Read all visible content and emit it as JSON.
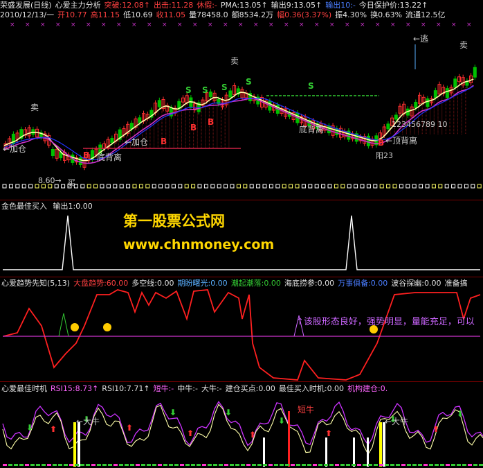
{
  "header": {
    "line1": [
      {
        "text": "荣盛发展(日线)",
        "color": "#e0e0e0"
      },
      {
        "text": "心爱主力分析",
        "color": "#e0e0e0"
      },
      {
        "text": "突破:12.08↑",
        "color": "#ff4040"
      },
      {
        "text": "出击:11.28",
        "color": "#ff4040"
      },
      {
        "text": "休假:-",
        "color": "#ff4040"
      },
      {
        "text": "PMA:13.05↑",
        "color": "#e0e0e0"
      },
      {
        "text": "输出9:13.05↑",
        "color": "#e0e0e0"
      },
      {
        "text": "输出10:-",
        "color": "#4a7dff"
      },
      {
        "text": "今日保护价:13.22↑",
        "color": "#e0e0e0"
      }
    ],
    "line2": [
      {
        "text": "2010/12/13/一",
        "color": "#e0e0e0"
      },
      {
        "text": "开10.77",
        "color": "#ff4040"
      },
      {
        "text": "高11.15",
        "color": "#ff4040"
      },
      {
        "text": "低10.69",
        "color": "#e0e0e0"
      },
      {
        "text": "收11.05",
        "color": "#ff4040"
      },
      {
        "text": "量78458.0",
        "color": "#e0e0e0"
      },
      {
        "text": "额8534.2万",
        "color": "#e0e0e0"
      },
      {
        "text": "幅0.36(3.37%)",
        "color": "#ff4040"
      },
      {
        "text": "振4.30%",
        "color": "#e0e0e0"
      },
      {
        "text": "换0.63%",
        "color": "#e0e0e0"
      },
      {
        "text": "流通12.5亿",
        "color": "#e0e0e0"
      }
    ]
  },
  "main_chart": {
    "labels": [
      {
        "text": "卖",
        "color": "#e0e0e0"
      },
      {
        "text": "←加仓",
        "color": "#e0e0e0"
      },
      {
        "text": "8.60→",
        "color": "#e0e0e0"
      },
      {
        "text": "买",
        "color": "#ff4040"
      },
      {
        "text": "底背离",
        "color": "#e0e0e0"
      },
      {
        "text": "←加仓",
        "color": "#e0e0e0"
      },
      {
        "text": "卖",
        "color": "#e0e0e0"
      },
      {
        "text": "底背离",
        "color": "#e0e0e0"
      },
      {
        "text": "←逃",
        "color": "#5ab0ff"
      },
      {
        "text": "卖",
        "color": "#e0e0e0"
      },
      {
        "text": "←顶背离",
        "color": "#e0e0e0"
      },
      {
        "text": "123456789 10",
        "color": "#33cc33"
      },
      {
        "text": "阳23",
        "color": "#33cc33"
      }
    ],
    "markers": [
      "S",
      "S",
      "S",
      "S",
      "S",
      "B",
      "B",
      "B",
      "B",
      "B"
    ]
  },
  "panel2": {
    "title": "金色最佳买入",
    "output": "输出1:0.00"
  },
  "watermark": {
    "cn": "第一股票公式网",
    "url": "www.chnmoney.com"
  },
  "panel3": {
    "items": [
      {
        "text": "心爱趋势先知(5,13)",
        "color": "#e0e0e0"
      },
      {
        "text": "大盘趋势:60.00",
        "color": "#ff4040"
      },
      {
        "text": "多空线:0.00",
        "color": "#e0e0e0"
      },
      {
        "text": "期盼曙光:0.00",
        "color": "#5ab0ff"
      },
      {
        "text": "潮起潮落:0.00",
        "color": "#33cc33"
      },
      {
        "text": "海底捞参:0.00",
        "color": "#e0e0e0"
      },
      {
        "text": "万事俱备:0.00",
        "color": "#4a7dff"
      },
      {
        "text": "波谷探幽:0.00",
        "color": "#e0e0e0"
      },
      {
        "text": "准备搞",
        "color": "#e0e0e0"
      }
    ],
    "scroll_text": "↑该股形态良好，强势明显，量能充足，可以"
  },
  "panel4": {
    "items": [
      {
        "text": "心爱最佳时机",
        "color": "#e0e0e0"
      },
      {
        "text": "RSI15:8.73↑",
        "color": "#ff66ff"
      },
      {
        "text": "RSI10:7.71↑",
        "color": "#e0e0e0"
      },
      {
        "text": "短牛:-",
        "color": "#ff66ff"
      },
      {
        "text": "中牛:-",
        "color": "#e0e0e0"
      },
      {
        "text": "大牛:-",
        "color": "#e0e0e0"
      },
      {
        "text": "建仓买点:0.00",
        "color": "#e0e0e0"
      },
      {
        "text": "最佳买入时机:0.00",
        "color": "#e0e0e0"
      },
      {
        "text": "机构建仓:0.",
        "color": "#ff66ff"
      }
    ],
    "labels": [
      {
        "text": "←大牛",
        "color": "#e0e0e0"
      },
      {
        "text": "短牛",
        "color": "#ff4040"
      },
      {
        "text": "←大牛",
        "color": "#e0e0e0"
      }
    ]
  },
  "colors": {
    "up": "#ff3030",
    "down": "#00c000",
    "border": "#7a0000"
  }
}
